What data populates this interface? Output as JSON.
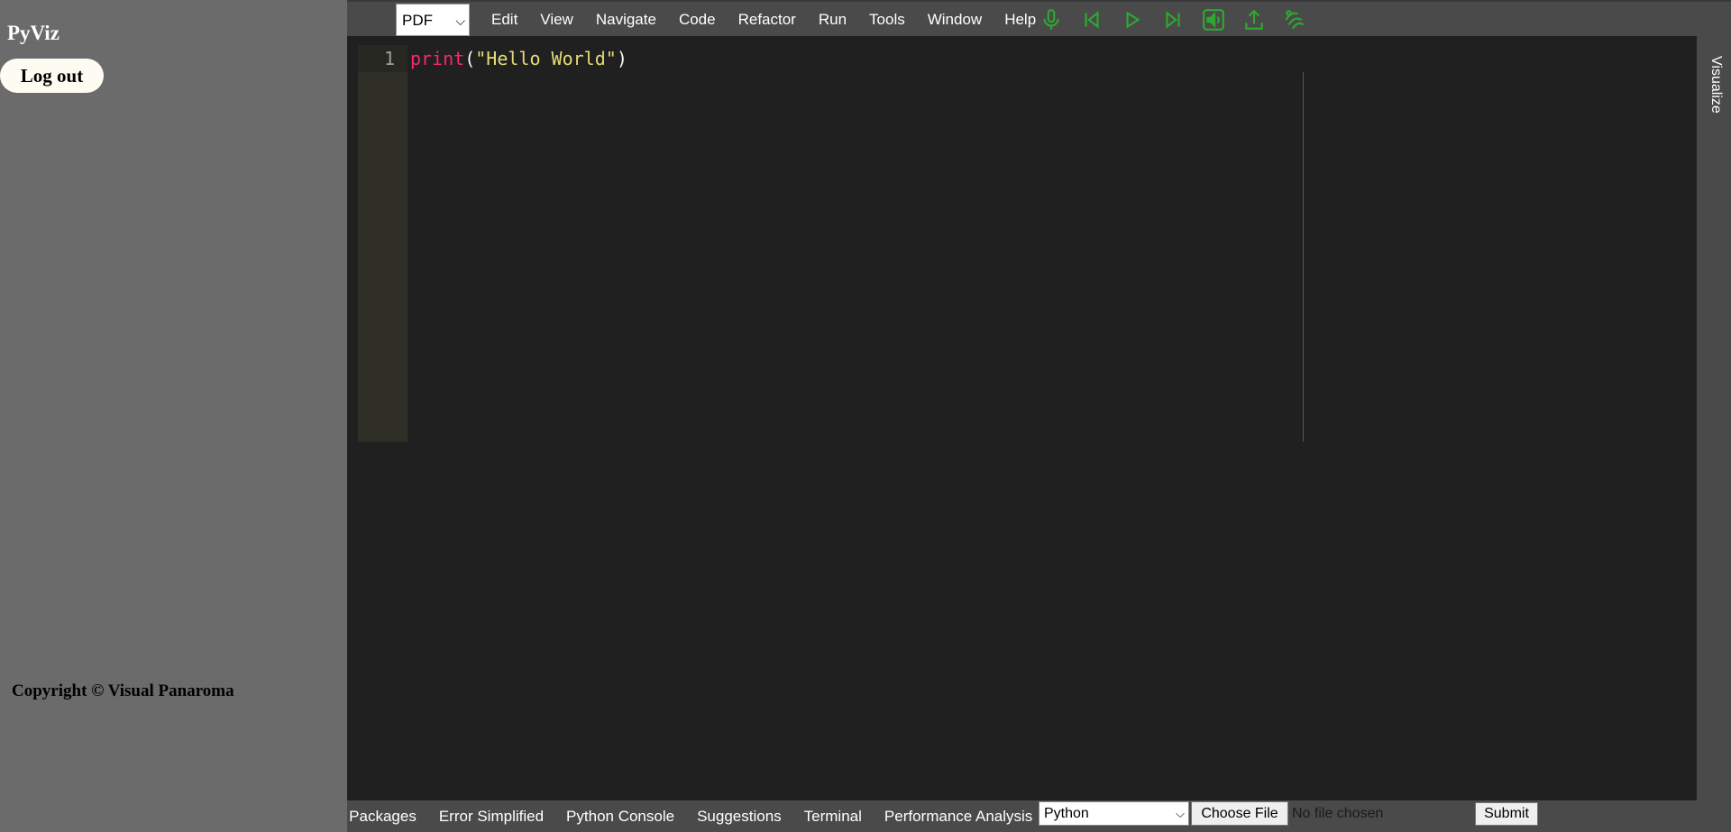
{
  "sidebar": {
    "brand": "PyViz",
    "logout_label": "Log out",
    "copyright": "Copyright © Visual Panaroma"
  },
  "topbar": {
    "export_select": "PDF",
    "menu": [
      "Edit",
      "View",
      "Navigate",
      "Code",
      "Refactor",
      "Run",
      "Tools",
      "Window",
      "Help"
    ],
    "icons": [
      "microphone-icon",
      "step-back-icon",
      "play-icon",
      "step-forward-icon",
      "speaker-icon",
      "upload-icon",
      "wave-hand-icon"
    ],
    "icon_color": "#2ea82e"
  },
  "editor": {
    "line_number": "1",
    "code": {
      "fn": "print",
      "open": "(",
      "str": "\"Hello World\"",
      "close": ")"
    }
  },
  "right_tab": {
    "label": "Visualize"
  },
  "bottombar": {
    "tabs": [
      "n Packages",
      "Error Simplified",
      "Python Console",
      "Suggestions",
      "Terminal",
      "Performance Analysis"
    ],
    "language_select": "Python",
    "choose_file_label": "Choose File",
    "file_status": "No file chosen",
    "submit_label": "Submit"
  }
}
